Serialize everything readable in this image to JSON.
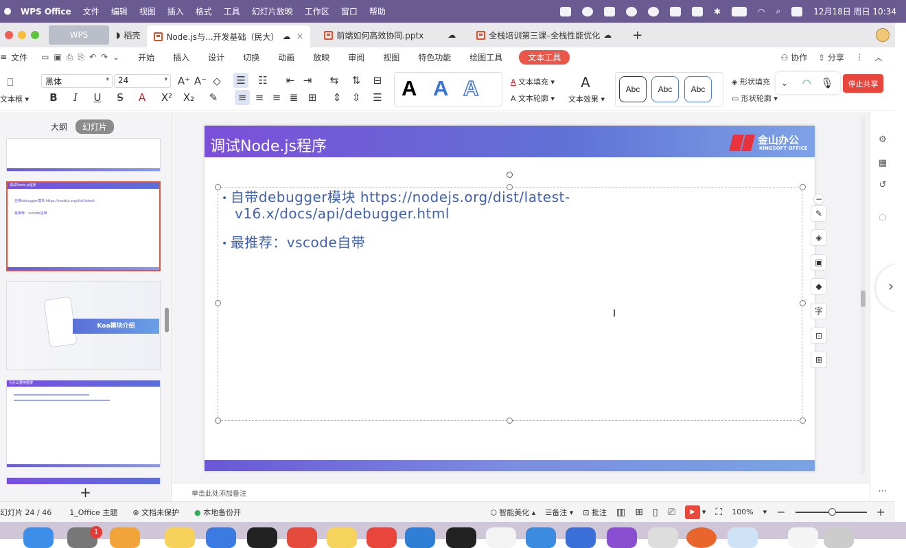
{
  "menubar": {
    "app": "WPS Office",
    "items": [
      "文件",
      "编辑",
      "视图",
      "插入",
      "格式",
      "工具",
      "幻灯片放映",
      "工作区",
      "窗口",
      "帮助"
    ],
    "clock": "12月18日 周日 10:34"
  },
  "tabs": [
    {
      "label": "WPS"
    },
    {
      "label": "稻壳"
    },
    {
      "label": "Node.js与...开发基础（民大）"
    },
    {
      "label": "前端如何高效协同.pptx"
    },
    {
      "label": "全栈培训第三课–全栈性能优化"
    }
  ],
  "ribbon": {
    "file_label": "文件",
    "tabs": [
      "开始",
      "插入",
      "设计",
      "切换",
      "动画",
      "放映",
      "审阅",
      "视图",
      "特色功能",
      "绘图工具",
      "文本工具"
    ],
    "collab": "协作",
    "share": "分享"
  },
  "toolbar": {
    "textbox_label": "文本框",
    "font_name": "黑体",
    "font_size": "24",
    "text_fill": "文本填充",
    "text_outline": "文本轮廓",
    "text_effect": "文本效果",
    "shape_fill": "形状填充",
    "shape_outline": "形状轮廓",
    "abc": "Abc",
    "stop_share": "停止共享"
  },
  "leftpanel": {
    "tab_outline": "大纲",
    "tab_slides": "幻灯片",
    "thumb_koa": "Koa模块介绍",
    "thumb_title_a": "调试Node.js程序",
    "thumb_title_b": "为什么要用框架"
  },
  "slide": {
    "title": "调试Node.js程序",
    "logo": "金山办公",
    "logo_sub": "KINGSOFT OFFICE",
    "bullets": [
      {
        "line1": "自带debugger模块 https://nodejs.org/dist/latest-",
        "line2": "v16.x/docs/api/debugger.html"
      },
      {
        "line1": "最推荐：vscode自带",
        "line2": ""
      }
    ]
  },
  "notes_placeholder": "单击此处添加备注",
  "status": {
    "slide_counter": "幻灯片 24 / 46",
    "theme": "1_Office 主题",
    "doc_protect": "文档未保护",
    "backup": "本地备份开",
    "beautify": "智能美化",
    "notes": "备注",
    "comment": "批注",
    "zoom": "100%"
  },
  "colors": {
    "accent": "#e8574a",
    "slide_title_start": "#7b4fd8",
    "slide_text": "#3f62b3"
  }
}
